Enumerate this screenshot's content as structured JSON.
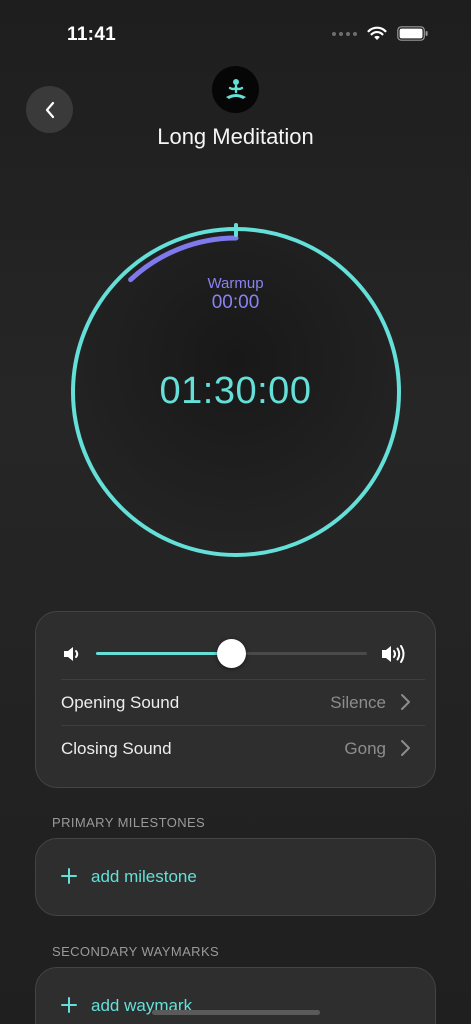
{
  "status_bar": {
    "time": "11:41"
  },
  "header": {
    "title": "Long Meditation"
  },
  "timer": {
    "warmup_label": "Warmup",
    "warmup_value": "00:00",
    "duration": "01:30:00",
    "warmup_progress_fraction": 0.12
  },
  "sound": {
    "volume_fraction": 0.5,
    "opening_label": "Opening Sound",
    "opening_value": "Silence",
    "closing_label": "Closing Sound",
    "closing_value": "Gong"
  },
  "milestones": {
    "section_title": "PRIMARY MILESTONES",
    "add_label": "add milestone"
  },
  "waymarks": {
    "section_title": "SECONDARY WAYMARKS",
    "add_label": "add waymark"
  },
  "colors": {
    "accent": "#64e0d8",
    "warmup": "#8a83f0",
    "background": "#232323"
  },
  "icons": {
    "back": "chevron-left-icon",
    "app": "meditation-icon",
    "volume_low": "speaker-low-icon",
    "volume_high": "speaker-high-icon",
    "chevron": "chevron-right-icon",
    "add": "plus-icon"
  }
}
